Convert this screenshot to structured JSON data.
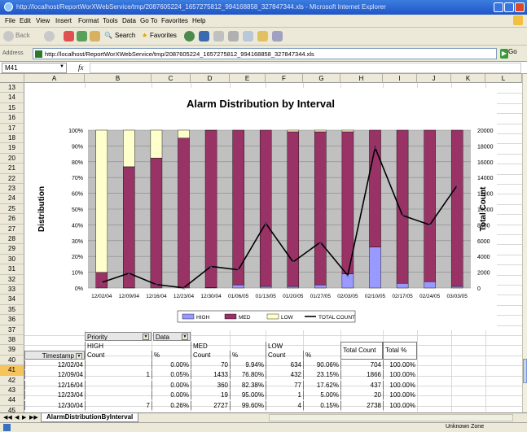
{
  "window": {
    "title": "http://localhost/ReportWorXWebService/tmp/2087605224_1657275812_994168858_327847344.xls - Microsoft Internet Explorer"
  },
  "menu": [
    "File",
    "Edit",
    "View",
    "Insert",
    "Format",
    "Tools",
    "Data",
    "Go To",
    "Favorites",
    "Help"
  ],
  "toolbar": {
    "back": "Back",
    "search": "Search",
    "favorites": "Favorites"
  },
  "address": {
    "label": "Address",
    "url": "http://localhost/ReportWorXWebService/tmp/2087605224_1657275812_994168858_327847344.xls",
    "go": "Go"
  },
  "formula_bar": {
    "name_box": "M41",
    "fx": "fx"
  },
  "columns": [
    "A",
    "B",
    "C",
    "D",
    "E",
    "F",
    "G",
    "H",
    "I",
    "J",
    "K",
    "L"
  ],
  "rows": [
    "13",
    "14",
    "15",
    "16",
    "17",
    "18",
    "19",
    "20",
    "21",
    "22",
    "23",
    "24",
    "25",
    "26",
    "27",
    "28",
    "29",
    "30",
    "31",
    "32",
    "33",
    "34",
    "35",
    "36",
    "37",
    "38",
    "39",
    "40",
    "41",
    "42",
    "43",
    "44",
    "45"
  ],
  "selected_row": "41",
  "colors": {
    "high": "#9999ff",
    "med": "#993366",
    "low": "#ffffcc",
    "total": "#000000"
  },
  "chart_data": {
    "type": "bar",
    "stacked": true,
    "title": "Alarm Distribution by Interval",
    "ylabel": "Distribution",
    "y2label": "Total Count",
    "ylim": [
      0,
      100
    ],
    "y2lim": [
      0,
      20000
    ],
    "yticks": [
      "0%",
      "10%",
      "20%",
      "30%",
      "40%",
      "50%",
      "60%",
      "70%",
      "80%",
      "90%",
      "100%"
    ],
    "y2ticks": [
      "0",
      "2000",
      "4000",
      "6000",
      "8000",
      "10000",
      "12000",
      "14000",
      "16000",
      "18000",
      "20000"
    ],
    "categories": [
      "12/02/04",
      "12/09/04",
      "12/16/04",
      "12/23/04",
      "12/30/04",
      "01/06/05",
      "01/13/05",
      "01/20/05",
      "01/27/05",
      "02/03/05",
      "02/10/05",
      "02/17/05",
      "02/24/05",
      "03/03/05"
    ],
    "series": [
      {
        "name": "HIGH",
        "values": [
          0,
          0.05,
          0,
          0,
          0.26,
          2,
          1,
          1,
          2,
          9,
          26,
          3,
          4,
          1
        ]
      },
      {
        "name": "MED",
        "values": [
          9.94,
          76.8,
          82.38,
          95,
          99.6,
          98,
          99,
          98,
          97,
          90,
          74,
          97,
          96,
          99
        ]
      },
      {
        "name": "LOW",
        "values": [
          90.06,
          23.15,
          17.62,
          5,
          0.15,
          0,
          0,
          1,
          1,
          1,
          0,
          0,
          0,
          0
        ]
      },
      {
        "name": "TOTAL COUNT",
        "axis": "right",
        "values": [
          704,
          1866,
          437,
          20,
          2738,
          2300,
          8200,
          3300,
          5800,
          1600,
          17800,
          9200,
          8000,
          13000
        ]
      }
    ],
    "legend": [
      "HIGH",
      "MED",
      "LOW",
      "TOTAL COUNT"
    ],
    "legend_position": "bottom"
  },
  "pivot": {
    "priority_label": "Priority",
    "data_label": "Data",
    "group_high": "HIGH",
    "group_med": "MED",
    "group_low": "LOW",
    "total_count": "Total Count",
    "total_pct": "Total %",
    "timestamp": "Timestamp",
    "count": "Count",
    "pct": "%",
    "rows": [
      {
        "ts": "12/02/04",
        "hc": "",
        "hp": "0.00%",
        "mc": "70",
        "mp": "9.94%",
        "lc": "634",
        "lp": "90.06%",
        "tc": "704",
        "tp": "100.00%"
      },
      {
        "ts": "12/09/04",
        "hc": "1",
        "hp": "0.05%",
        "mc": "1433",
        "mp": "76.80%",
        "lc": "432",
        "lp": "23.15%",
        "tc": "1866",
        "tp": "100.00%"
      },
      {
        "ts": "12/16/04",
        "hc": "",
        "hp": "0.00%",
        "mc": "360",
        "mp": "82.38%",
        "lc": "77",
        "lp": "17.62%",
        "tc": "437",
        "tp": "100.00%"
      },
      {
        "ts": "12/23/04",
        "hc": "",
        "hp": "0.00%",
        "mc": "19",
        "mp": "95.00%",
        "lc": "1",
        "lp": "5.00%",
        "tc": "20",
        "tp": "100.00%"
      },
      {
        "ts": "12/30/04",
        "hc": "7",
        "hp": "0.26%",
        "mc": "2727",
        "mp": "99.60%",
        "lc": "4",
        "lp": "0.15%",
        "tc": "2738",
        "tp": "100.00%"
      }
    ]
  },
  "sheet_tab": "AlarmDistributionByInterval",
  "status": {
    "zone": "Unknown Zone"
  }
}
